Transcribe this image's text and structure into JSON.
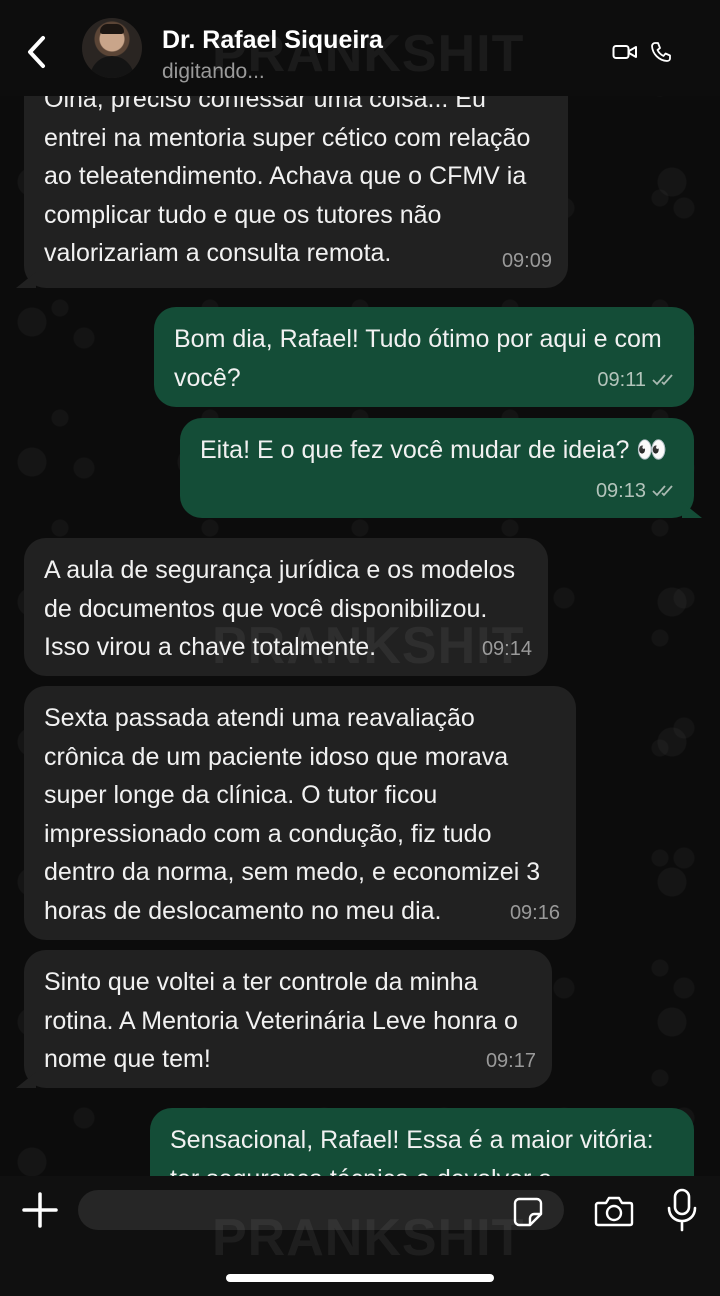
{
  "header": {
    "contact_name": "Dr. Rafael Siqueira",
    "status": "digitando..."
  },
  "watermark": "PRANKSHIT",
  "messages": [
    {
      "direction": "in",
      "text": "Olha, preciso confessar uma coisa... Eu\nentrei na mentoria super cético com relação\nao teleatendimento. Achava que o CFMV ia\ncomplicar tudo e que os tutores não\nvalorizariam a consulta remota.",
      "time": "09:09"
    },
    {
      "direction": "out",
      "text": "Bom dia, Rafael! Tudo ótimo por aqui e com\nvocê?",
      "time": "09:11",
      "status": "read"
    },
    {
      "direction": "out",
      "text": "Eita! E o que fez você mudar de ideia? 👀",
      "time": "09:13",
      "status": "read"
    },
    {
      "direction": "in",
      "text": "A aula de segurança jurídica e os modelos\nde documentos que você disponibilizou.\nIsso virou a chave totalmente.",
      "time": "09:14"
    },
    {
      "direction": "in",
      "text": "Sexta passada atendi uma reavaliação\ncrônica de um paciente idoso que morava\nsuper longe da clínica. O tutor ficou\nimpressionado com a condução, fiz tudo\ndentro da norma, sem medo, e economizei 3\nhoras de deslocamento no meu dia.",
      "time": "09:16"
    },
    {
      "direction": "in",
      "text": "Sinto que voltei a ter controle da minha\nrotina. A Mentoria Veterinária Leve honra o\nnome que tem!",
      "time": "09:17"
    },
    {
      "direction": "out",
      "text": "Sensacional, Rafael! Essa é a maior vitória:\nter segurança técnica e devolver a",
      "time": ""
    }
  ],
  "composer": {
    "placeholder": ""
  },
  "colors": {
    "incoming_bubble": "#212121",
    "outgoing_bubble": "#144d37",
    "background": "#0c0c0c"
  },
  "icons": [
    "back-arrow-icon",
    "video-call-icon",
    "phone-icon",
    "plus-icon",
    "sticker-icon",
    "camera-icon",
    "microphone-icon",
    "double-check-icon"
  ]
}
